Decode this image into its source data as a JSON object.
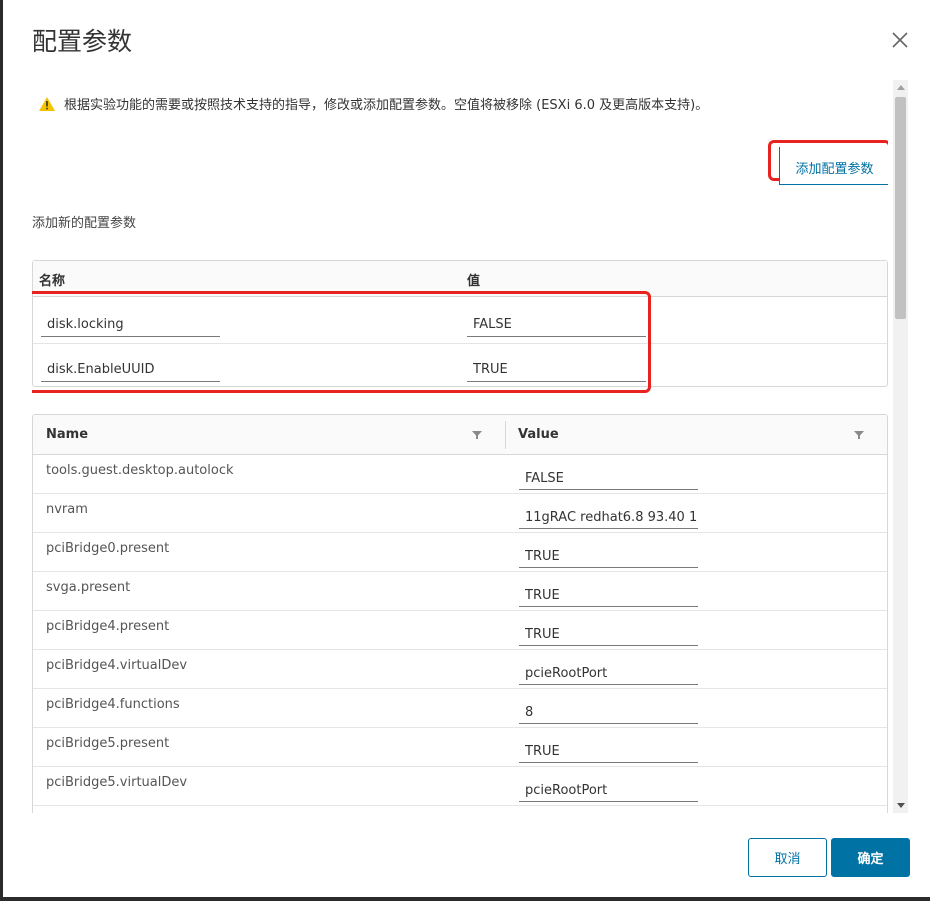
{
  "dialog": {
    "title": "配置参数",
    "warning": "根据实验功能的需要或按照技术支持的指导，修改或添加配置参数。空值将被移除 (ESXi 6.0 及更高版本支持)。",
    "add_button": "添加配置参数",
    "new_section_label": "添加新的配置参数",
    "cancel_button": "取消",
    "ok_button": "确定"
  },
  "new_params": {
    "header_name": "名称",
    "header_value": "值",
    "rows": [
      {
        "name": "disk.locking",
        "value": "FALSE"
      },
      {
        "name": "disk.EnableUUID",
        "value": "TRUE"
      }
    ]
  },
  "grid": {
    "header_name": "Name",
    "header_value": "Value",
    "rows": [
      {
        "name": "tools.guest.desktop.autolock",
        "value": "FALSE"
      },
      {
        "name": "nvram",
        "value": "11gRAC redhat6.8 93.40 1"
      },
      {
        "name": "pciBridge0.present",
        "value": "TRUE"
      },
      {
        "name": "svga.present",
        "value": "TRUE"
      },
      {
        "name": "pciBridge4.present",
        "value": "TRUE"
      },
      {
        "name": "pciBridge4.virtualDev",
        "value": "pcieRootPort"
      },
      {
        "name": "pciBridge4.functions",
        "value": "8"
      },
      {
        "name": "pciBridge5.present",
        "value": "TRUE"
      },
      {
        "name": "pciBridge5.virtualDev",
        "value": "pcieRootPort"
      },
      {
        "name": "",
        "value": ""
      }
    ]
  },
  "colors": {
    "accent": "#0072a3",
    "highlight": "#e8231f",
    "warning": "#f5c400"
  },
  "icons": {
    "close": "close-icon",
    "warning": "warning-icon",
    "filter": "filter-icon"
  }
}
